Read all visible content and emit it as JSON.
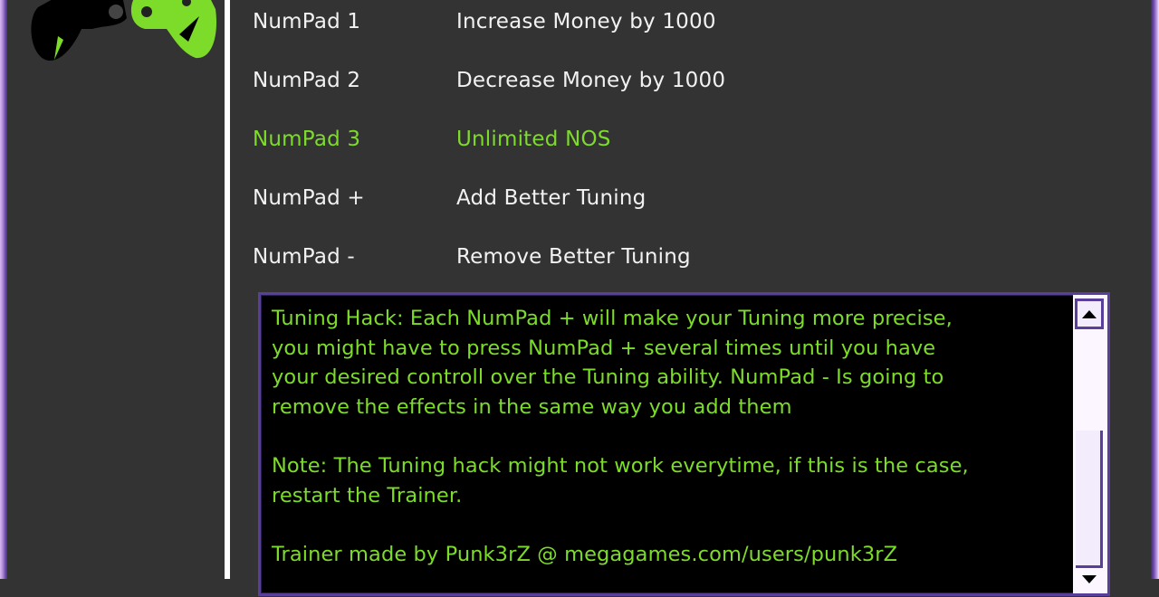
{
  "theme": {
    "background": "#333333",
    "accent_green": "#7ddc2a",
    "frame_purple": "#5a3f9a",
    "text_white": "#f2f2f2"
  },
  "logo": {
    "icon": "gamepad-icon"
  },
  "hotkeys": [
    {
      "key": "NumPad 1",
      "action": "Increase Money by 1000",
      "active": false
    },
    {
      "key": "NumPad 2",
      "action": "Decrease Money by 1000",
      "active": false
    },
    {
      "key": "NumPad 3",
      "action": "Unlimited NOS",
      "active": true
    },
    {
      "key": "NumPad +",
      "action": "Add Better Tuning",
      "active": false
    },
    {
      "key": "NumPad -",
      "action": "Remove Better Tuning",
      "active": false
    }
  ],
  "info_box": {
    "text": "Tuning Hack: Each NumPad + will make your Tuning more precise,\nyou might have to press NumPad + several times until you have\nyour desired controll over the Tuning ability. NumPad - Is going to\nremove the effects in the same way you add them\n\nNote: The Tuning hack might not work everytime, if this is the case,\nrestart the Trainer.\n\nTrainer made by Punk3rZ @ megagames.com/users/punk3rZ",
    "scroll_position": 0.5
  }
}
